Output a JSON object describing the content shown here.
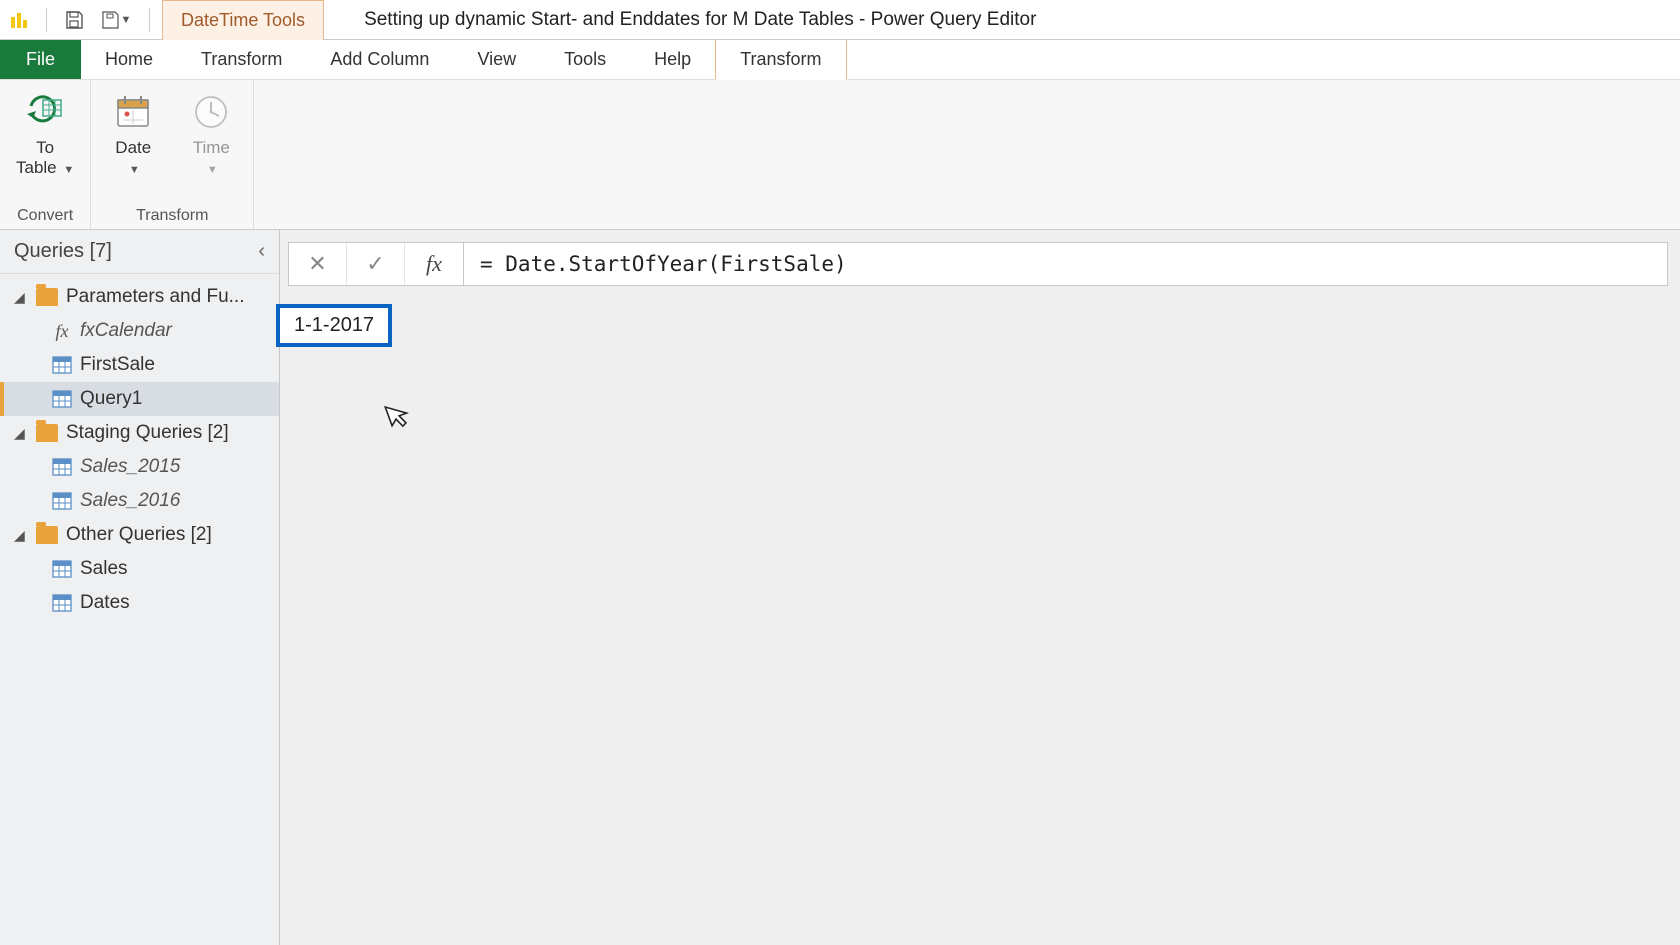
{
  "titlebar": {
    "context_tab": "DateTime Tools",
    "doc_title": "Setting up dynamic Start- and Enddates for M Date Tables - Power Query Editor"
  },
  "tabs": {
    "file": "File",
    "home": "Home",
    "transform": "Transform",
    "add_column": "Add Column",
    "view": "View",
    "tools": "Tools",
    "help": "Help",
    "context_transform": "Transform"
  },
  "ribbon": {
    "convert": {
      "to_table": "To\nTable",
      "group_title": "Convert"
    },
    "transform": {
      "date": "Date",
      "time": "Time",
      "group_title": "Transform"
    }
  },
  "queries": {
    "header": "Queries [7]",
    "folders": [
      {
        "label": "Parameters and Fu...",
        "children": [
          {
            "label": "fxCalendar",
            "type": "fx",
            "italic": true
          },
          {
            "label": "FirstSale",
            "type": "table"
          },
          {
            "label": "Query1",
            "type": "table",
            "selected": true
          }
        ]
      },
      {
        "label": "Staging Queries [2]",
        "children": [
          {
            "label": "Sales_2015",
            "type": "table",
            "italic": true
          },
          {
            "label": "Sales_2016",
            "type": "table",
            "italic": true
          }
        ]
      },
      {
        "label": "Other Queries [2]",
        "children": [
          {
            "label": "Sales",
            "type": "table"
          },
          {
            "label": "Dates",
            "type": "table"
          }
        ]
      }
    ]
  },
  "formula": {
    "text": "= Date.StartOfYear(FirstSale)"
  },
  "result": {
    "value": "1-1-2017"
  }
}
